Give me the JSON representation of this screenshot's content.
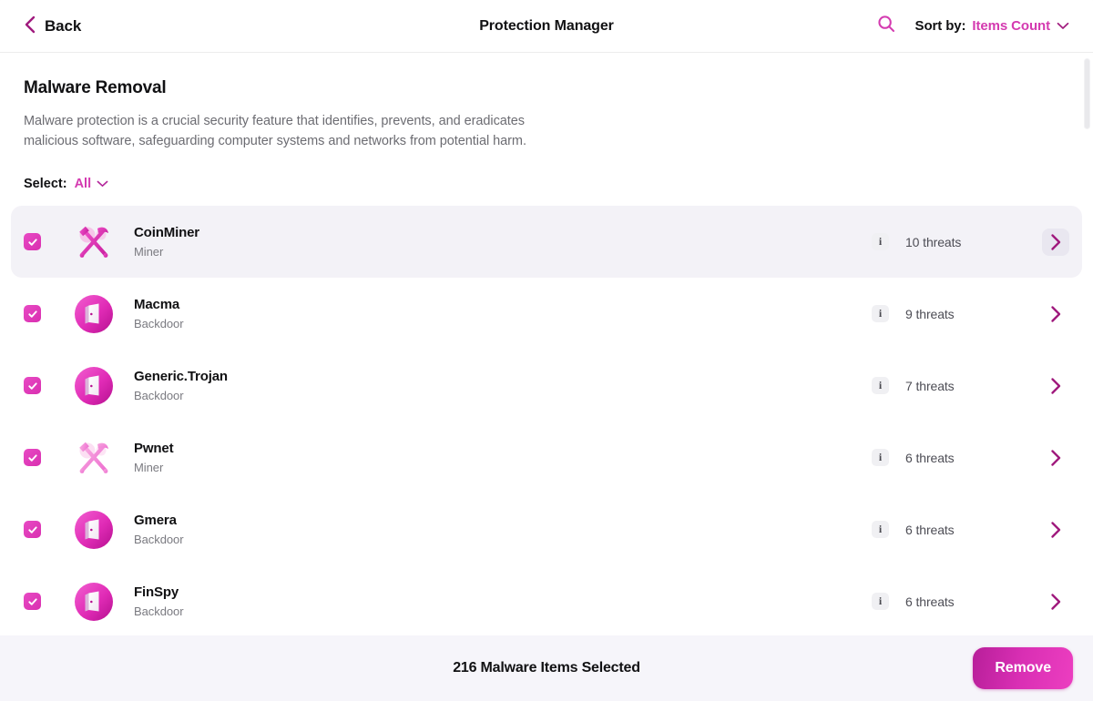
{
  "header": {
    "back_label": "Back",
    "title": "Protection Manager",
    "search_icon": "search-icon",
    "sort_by_label": "Sort by:",
    "sort_by_value": "Items Count",
    "sort_chevron_icon": "chevron-down-icon"
  },
  "section": {
    "title": "Malware Removal",
    "description": "Malware protection is a crucial security feature that identifies, prevents, and eradicates malicious software, safeguarding computer systems and networks from potential harm.",
    "select_label": "Select:",
    "select_value": "All",
    "select_chevron_icon": "chevron-down-icon"
  },
  "list": {
    "info_glyph": "i",
    "items": [
      {
        "name": "CoinMiner",
        "type": "Miner",
        "icon": "miner-icon",
        "threats": "10 threats",
        "checked": true,
        "selected": true
      },
      {
        "name": "Macma",
        "type": "Backdoor",
        "icon": "backdoor-icon",
        "threats": "9 threats",
        "checked": true,
        "selected": false
      },
      {
        "name": "Generic.Trojan",
        "type": "Backdoor",
        "icon": "backdoor-icon",
        "threats": "7 threats",
        "checked": true,
        "selected": false
      },
      {
        "name": "Pwnet",
        "type": "Miner",
        "icon": "miner-icon",
        "threats": "6 threats",
        "checked": true,
        "selected": false
      },
      {
        "name": "Gmera",
        "type": "Backdoor",
        "icon": "backdoor-icon",
        "threats": "6 threats",
        "checked": true,
        "selected": false
      },
      {
        "name": "FinSpy",
        "type": "Backdoor",
        "icon": "backdoor-icon",
        "threats": "6 threats",
        "checked": true,
        "selected": false
      }
    ]
  },
  "bottom": {
    "status": "216 Malware Items Selected",
    "remove_label": "Remove"
  },
  "colors": {
    "accent": "#d43ab0",
    "accent_deep": "#a01a7d",
    "row_selected_bg": "#f3f2f7",
    "desktop_bg": "#8a0f5c",
    "text_primary": "#111113",
    "text_secondary": "#6c6c72"
  }
}
